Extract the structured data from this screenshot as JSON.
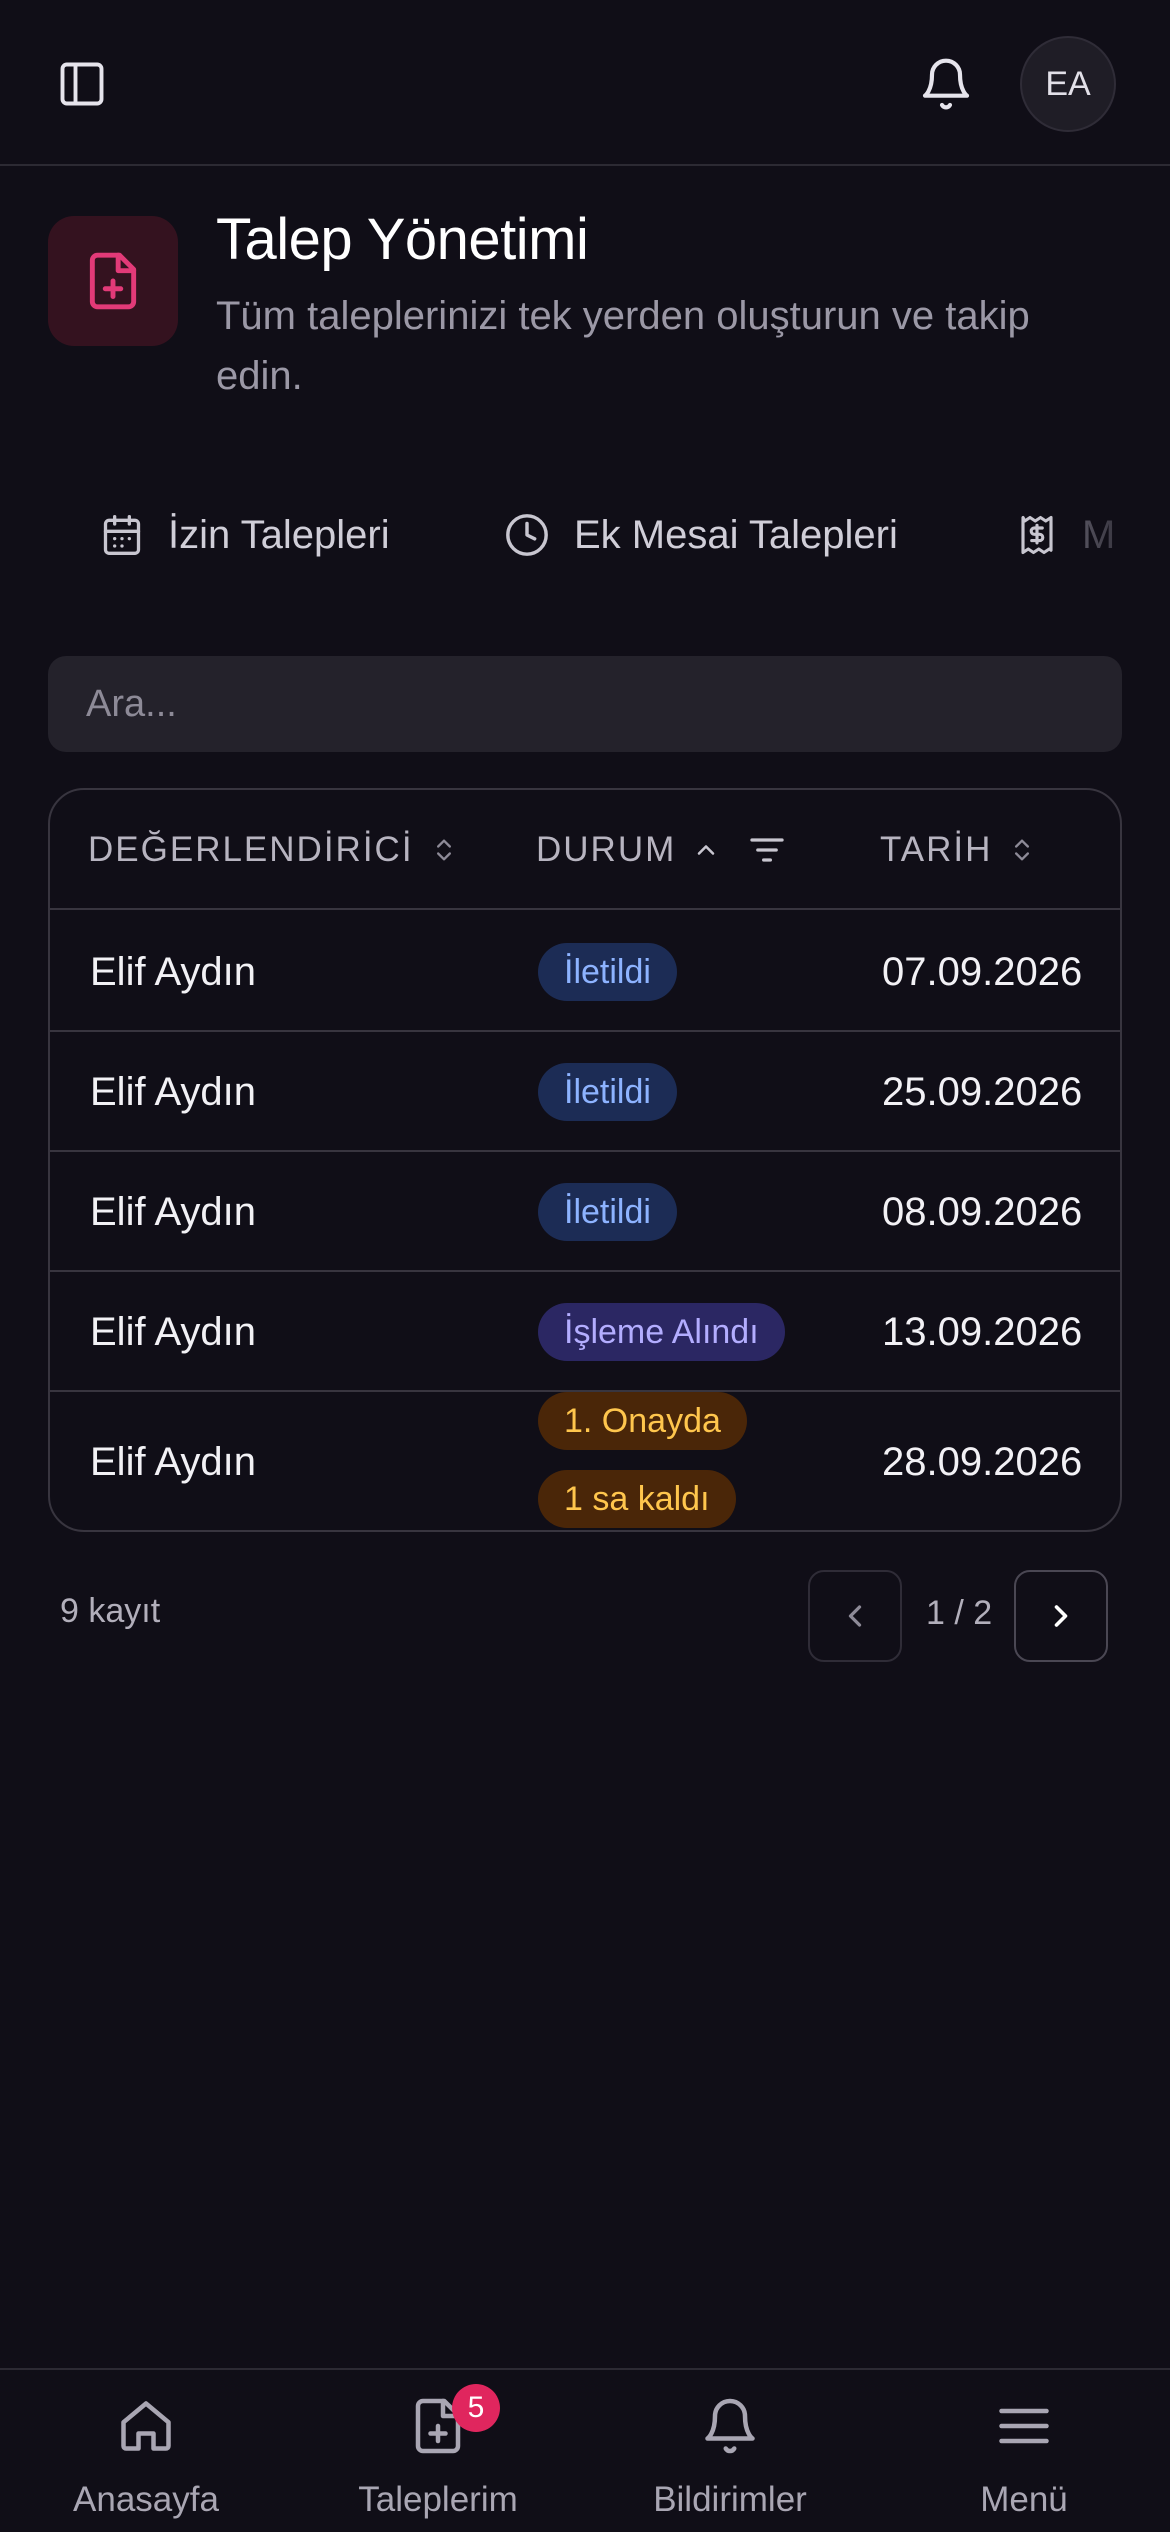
{
  "topbar": {
    "avatar_initials": "EA",
    "icons": [
      "sidebar-toggle-icon",
      "bell-icon"
    ]
  },
  "header": {
    "title": "Talep Yönetimi",
    "subtitle": "Tüm taleplerinizi tek yerden oluşturun ve takip edin.",
    "icon": "file-plus-icon",
    "accent_color": "#e23a78"
  },
  "tabs": [
    {
      "label": "İzin Talepleri",
      "icon": "calendar-icon"
    },
    {
      "label": "Ek Mesai Talepleri",
      "icon": "clock-icon"
    },
    {
      "label": "M",
      "icon": "receipt-dollar-icon"
    }
  ],
  "search": {
    "placeholder": "Ara...",
    "value": ""
  },
  "table": {
    "columns": [
      {
        "label": "DEĞERLENDİRİCİ",
        "sort": "unsorted"
      },
      {
        "label": "DURUM",
        "sort": "ascending",
        "filter": true
      },
      {
        "label": "TARİH",
        "sort": "unsorted"
      }
    ],
    "rows": [
      {
        "evaluator": "Elif Aydın",
        "statuses": [
          {
            "label": "İletildi",
            "color": "#8db3ff"
          }
        ],
        "date": "07.09.2026"
      },
      {
        "evaluator": "Elif Aydın",
        "statuses": [
          {
            "label": "İletildi",
            "color": "#8db3ff"
          }
        ],
        "date": "25.09.2026"
      },
      {
        "evaluator": "Elif Aydın",
        "statuses": [
          {
            "label": "İletildi",
            "color": "#8db3ff"
          }
        ],
        "date": "08.09.2026"
      },
      {
        "evaluator": "Elif Aydın",
        "statuses": [
          {
            "label": "İşleme Alındı",
            "color": "#b3adff"
          }
        ],
        "date": "13.09.2026"
      },
      {
        "evaluator": "Elif Aydın",
        "statuses": [
          {
            "label": "1. Onayda",
            "color": "#ffc64d"
          },
          {
            "label": "1 sa kaldı",
            "color": "#ffc64d"
          }
        ],
        "date": "28.09.2026"
      }
    ]
  },
  "pagination": {
    "record_count": "9 kayıt",
    "page_text": "1 / 2"
  },
  "bottom_nav": [
    {
      "label": "Anasayfa",
      "icon": "home-icon"
    },
    {
      "label": "Taleplerim",
      "icon": "file-plus-icon",
      "badge": "5"
    },
    {
      "label": "Bildirimler",
      "icon": "bell-icon"
    },
    {
      "label": "Menü",
      "icon": "menu-icon"
    }
  ]
}
